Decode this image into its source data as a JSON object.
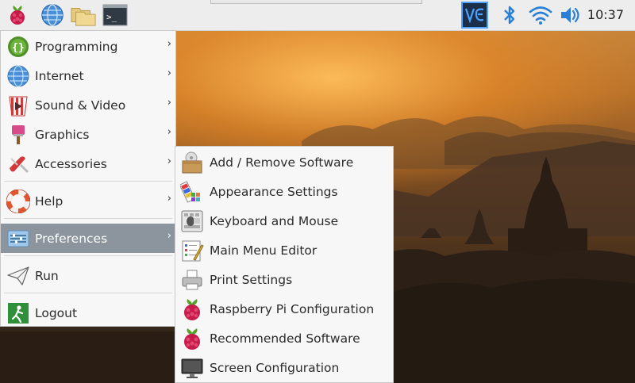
{
  "panel": {
    "clock": "10:37",
    "icons": [
      "raspberry-menu-icon",
      "web-browser-icon",
      "file-manager-icon",
      "terminal-icon",
      "vnc-icon",
      "bluetooth-icon",
      "wifi-icon",
      "volume-icon"
    ],
    "accent": "#2a7fd6"
  },
  "main_menu": {
    "items": [
      {
        "label": "Programming",
        "icon": "programming-icon",
        "submenu": true
      },
      {
        "label": "Internet",
        "icon": "internet-icon",
        "submenu": true
      },
      {
        "label": "Sound & Video",
        "icon": "sound-video-icon",
        "submenu": true
      },
      {
        "label": "Graphics",
        "icon": "graphics-icon",
        "submenu": true
      },
      {
        "label": "Accessories",
        "icon": "accessories-icon",
        "submenu": true
      },
      {
        "label": "Help",
        "icon": "help-icon",
        "submenu": true
      },
      {
        "label": "Preferences",
        "icon": "preferences-icon",
        "submenu": true,
        "active": true
      },
      {
        "label": "Run",
        "icon": "run-icon",
        "submenu": false
      },
      {
        "label": "Logout",
        "icon": "logout-icon",
        "submenu": false
      }
    ],
    "arrow": "›"
  },
  "preferences_menu": {
    "items": [
      {
        "label": "Add / Remove Software",
        "icon": "package-icon"
      },
      {
        "label": "Appearance Settings",
        "icon": "appearance-icon"
      },
      {
        "label": "Keyboard and Mouse",
        "icon": "keyboard-mouse-icon"
      },
      {
        "label": "Main Menu Editor",
        "icon": "menu-editor-icon"
      },
      {
        "label": "Print Settings",
        "icon": "printer-icon"
      },
      {
        "label": "Raspberry Pi Configuration",
        "icon": "raspberry-icon"
      },
      {
        "label": "Recommended Software",
        "icon": "raspberry-icon"
      },
      {
        "label": "Screen Configuration",
        "icon": "monitor-icon"
      }
    ]
  }
}
